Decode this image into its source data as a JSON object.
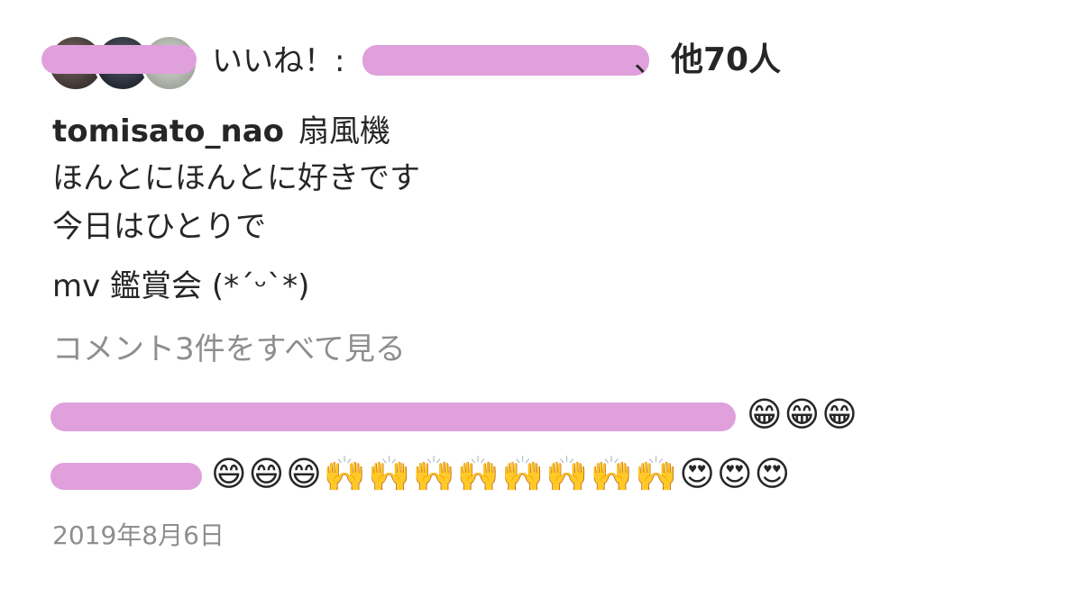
{
  "likes": {
    "label": "いいね！:",
    "separator": "、",
    "others_count": "他70人"
  },
  "caption": {
    "username": "tomisato_nao",
    "lines": [
      "扇風機",
      "ほんとにほんとに好きです",
      "今日はひとりで",
      "mv 鑑賞会 (*´ᵕ`*)"
    ]
  },
  "view_comments_label": "コメント3件をすべて見る",
  "comments": [
    {
      "emojis": "😁😁😁"
    },
    {
      "emojis": "😄😄😄🙌🙌🙌🙌🙌🙌🙌🙌😍😍😍"
    }
  ],
  "date": "2019年8月6日",
  "colors": {
    "redaction": "#dfa0dc",
    "muted": "#8e8e8e",
    "text": "#262626"
  }
}
